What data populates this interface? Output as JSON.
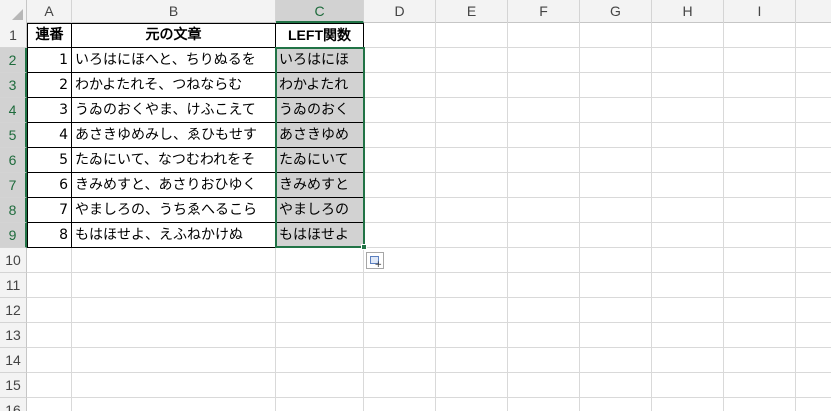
{
  "columns": [
    "A",
    "B",
    "C",
    "D",
    "E",
    "F",
    "G",
    "H",
    "I"
  ],
  "selected_column": "C",
  "rows": [
    "1",
    "2",
    "3",
    "4",
    "5",
    "6",
    "7",
    "8",
    "9",
    "10",
    "11",
    "12",
    "13",
    "14",
    "15",
    "16"
  ],
  "table": {
    "headers": {
      "a": "連番",
      "b": "元の文章",
      "c": "LEFT関数"
    },
    "data": [
      {
        "a": "1",
        "b": "いろはにほへと、ちりぬるを",
        "c": "いろはにほ"
      },
      {
        "a": "2",
        "b": "わかよたれそ、つねならむ",
        "c": "わかよたれ"
      },
      {
        "a": "3",
        "b": "うゐのおくやま、けふこえて",
        "c": "うゐのおく"
      },
      {
        "a": "4",
        "b": "あさきゆめみし、ゑひもせす",
        "c": "あさきゆめ"
      },
      {
        "a": "5",
        "b": "たゐにいて、なつむわれをそ",
        "c": "たゐにいて"
      },
      {
        "a": "6",
        "b": "きみめすと、あさりおひゆく",
        "c": "きみめすと"
      },
      {
        "a": "7",
        "b": "やましろの、うちゑへるこら",
        "c": "やましろの"
      },
      {
        "a": "8",
        "b": "もはほせよ、えふねかけぬ",
        "c": "もはほせよ"
      }
    ]
  },
  "icons": {
    "quick_analysis": "quick-analysis-icon",
    "select_all": "select-all-corner"
  },
  "colors": {
    "selection": "#217346",
    "selected_header_bg": "#d2d2d2",
    "header_bg": "#f3f3f3"
  }
}
